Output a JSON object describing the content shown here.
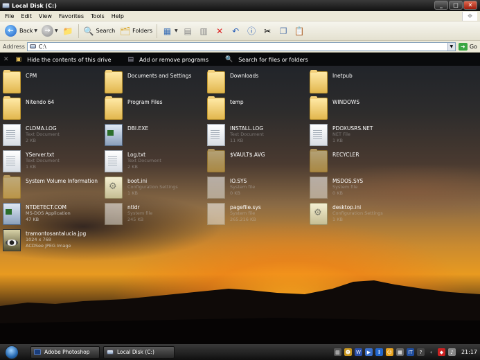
{
  "window": {
    "title": "Local Disk (C:)"
  },
  "menu": [
    "File",
    "Edit",
    "View",
    "Favorites",
    "Tools",
    "Help"
  ],
  "toolbar": {
    "back": "Back",
    "search": "Search",
    "folders": "Folders"
  },
  "address": {
    "label": "Address",
    "value": "C:\\",
    "go": "Go"
  },
  "tasks": [
    {
      "label": "Hide the contents of this drive",
      "icon": "hide-folder-icon"
    },
    {
      "label": "Add or remove programs",
      "icon": "add-remove-programs-icon"
    },
    {
      "label": "Search for files or folders",
      "icon": "search-icon"
    }
  ],
  "files": [
    {
      "name": "CPM",
      "type": "folder",
      "info1": "",
      "info2": ""
    },
    {
      "name": "Documents and Settings",
      "type": "folder",
      "info1": "",
      "info2": ""
    },
    {
      "name": "Downloads",
      "type": "folder",
      "info1": "",
      "info2": ""
    },
    {
      "name": "Inetpub",
      "type": "folder",
      "info1": "",
      "info2": ""
    },
    {
      "name": "Nitendo 64",
      "type": "folder",
      "info1": "",
      "info2": ""
    },
    {
      "name": "Program Files",
      "type": "folder",
      "info1": "",
      "info2": ""
    },
    {
      "name": "temp",
      "type": "folder",
      "info1": "",
      "info2": ""
    },
    {
      "name": "WINDOWS",
      "type": "folder",
      "info1": "",
      "info2": ""
    },
    {
      "name": "CLDMA.LOG",
      "type": "doc",
      "info1": "Text Document",
      "info2": "2 KB"
    },
    {
      "name": "DBI.EXE",
      "type": "exe",
      "info1": "",
      "info2": ""
    },
    {
      "name": "INSTALL.LOG",
      "type": "doc",
      "info1": "Text Document",
      "info2": "11 KB"
    },
    {
      "name": "PDOXUSRS.NET",
      "type": "doc",
      "info1": "NET File",
      "info2": "1 KB"
    },
    {
      "name": "YServer.txt",
      "type": "doc",
      "info1": "Text Document",
      "info2": "1 KB"
    },
    {
      "name": "Log.txt",
      "type": "doc",
      "info1": "Text Document",
      "info2": "2 KB"
    },
    {
      "name": "$VAULT$.AVG",
      "type": "folder-faded",
      "info1": "",
      "info2": ""
    },
    {
      "name": "RECYCLER",
      "type": "folder-faded",
      "info1": "",
      "info2": ""
    },
    {
      "name": "System Volume Information",
      "type": "folder-faded",
      "info1": "",
      "info2": ""
    },
    {
      "name": "boot.ini",
      "type": "gear",
      "info1": "Configuration Settings",
      "info2": "1 KB"
    },
    {
      "name": "IO.SYS",
      "type": "sys",
      "info1": "System file",
      "info2": "0 KB"
    },
    {
      "name": "MSDOS.SYS",
      "type": "sys",
      "info1": "System file",
      "info2": "0 KB"
    },
    {
      "name": "NTDETECT.COM",
      "type": "exe",
      "info1": "MS-DOS Application",
      "info2": "47 KB"
    },
    {
      "name": "ntldr",
      "type": "sys",
      "info1": "System file",
      "info2": "245 KB"
    },
    {
      "name": "pagefile.sys",
      "type": "sys",
      "info1": "System file",
      "info2": "265.216 KB"
    },
    {
      "name": "desktop.ini",
      "type": "gear",
      "info1": "Configuration Settings",
      "info2": "1 KB"
    },
    {
      "name": "tramontosantalucia.jpg",
      "type": "jpg",
      "info1": "1024 x 768",
      "info2": "ACDSee JPEG Image"
    }
  ],
  "taskbar": {
    "tasks": [
      {
        "label": "Adobe Photoshop",
        "icon": "photoshop-icon"
      },
      {
        "label": "Local Disk (C:)",
        "icon": "drive-icon"
      }
    ],
    "clock": "21:17"
  }
}
